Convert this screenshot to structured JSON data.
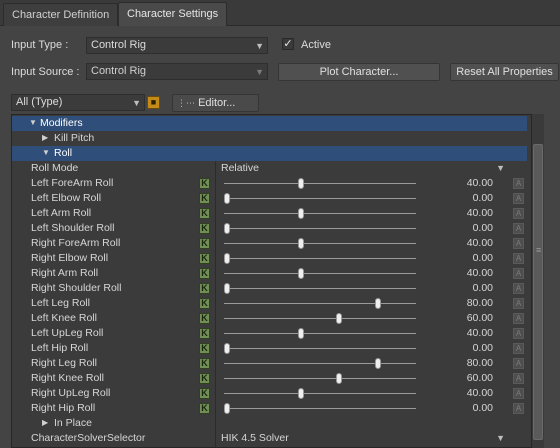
{
  "tabs": [
    {
      "label": "Character Definition"
    },
    {
      "label": "Character Settings"
    }
  ],
  "form": {
    "input_type_label": "Input Type :",
    "input_type_value": "Control Rig",
    "active_label": "Active",
    "active_checked": true,
    "input_source_label": "Input Source :",
    "input_source_value": "Control Rig",
    "plot_button": "Plot Character...",
    "reset_button": "Reset All Properties"
  },
  "filter": {
    "type_value": "All (Type)",
    "editor_button": "Editor..."
  },
  "tree": {
    "modifiers": "Modifiers",
    "kill_pitch": "Kill Pitch",
    "roll": "Roll",
    "roll_mode_label": "Roll Mode",
    "roll_mode_value": "Relative",
    "in_place": "In Place",
    "solver_label": "CharacterSolverSelector",
    "solver_value": "HIK 4.5 Solver"
  },
  "properties": [
    {
      "name": "Left ForeArm Roll",
      "value": "40.00",
      "fraction": 0.4
    },
    {
      "name": "Left Elbow Roll",
      "value": "0.00",
      "fraction": 0.0
    },
    {
      "name": "Left Arm Roll",
      "value": "40.00",
      "fraction": 0.4
    },
    {
      "name": "Left Shoulder Roll",
      "value": "0.00",
      "fraction": 0.0
    },
    {
      "name": "Right ForeArm Roll",
      "value": "40.00",
      "fraction": 0.4
    },
    {
      "name": "Right Elbow Roll",
      "value": "0.00",
      "fraction": 0.0
    },
    {
      "name": "Right Arm Roll",
      "value": "40.00",
      "fraction": 0.4
    },
    {
      "name": "Right Shoulder Roll",
      "value": "0.00",
      "fraction": 0.0
    },
    {
      "name": "Left Leg Roll",
      "value": "80.00",
      "fraction": 0.8
    },
    {
      "name": "Left Knee Roll",
      "value": "60.00",
      "fraction": 0.6
    },
    {
      "name": "Left UpLeg Roll",
      "value": "40.00",
      "fraction": 0.4
    },
    {
      "name": "Left Hip Roll",
      "value": "0.00",
      "fraction": 0.0
    },
    {
      "name": "Right Leg Roll",
      "value": "80.00",
      "fraction": 0.8
    },
    {
      "name": "Right Knee Roll",
      "value": "60.00",
      "fraction": 0.6
    },
    {
      "name": "Right UpLeg Roll",
      "value": "40.00",
      "fraction": 0.4
    },
    {
      "name": "Right Hip Roll",
      "value": "0.00",
      "fraction": 0.0
    }
  ],
  "key_button_label": "K",
  "anim_button_label": "A"
}
